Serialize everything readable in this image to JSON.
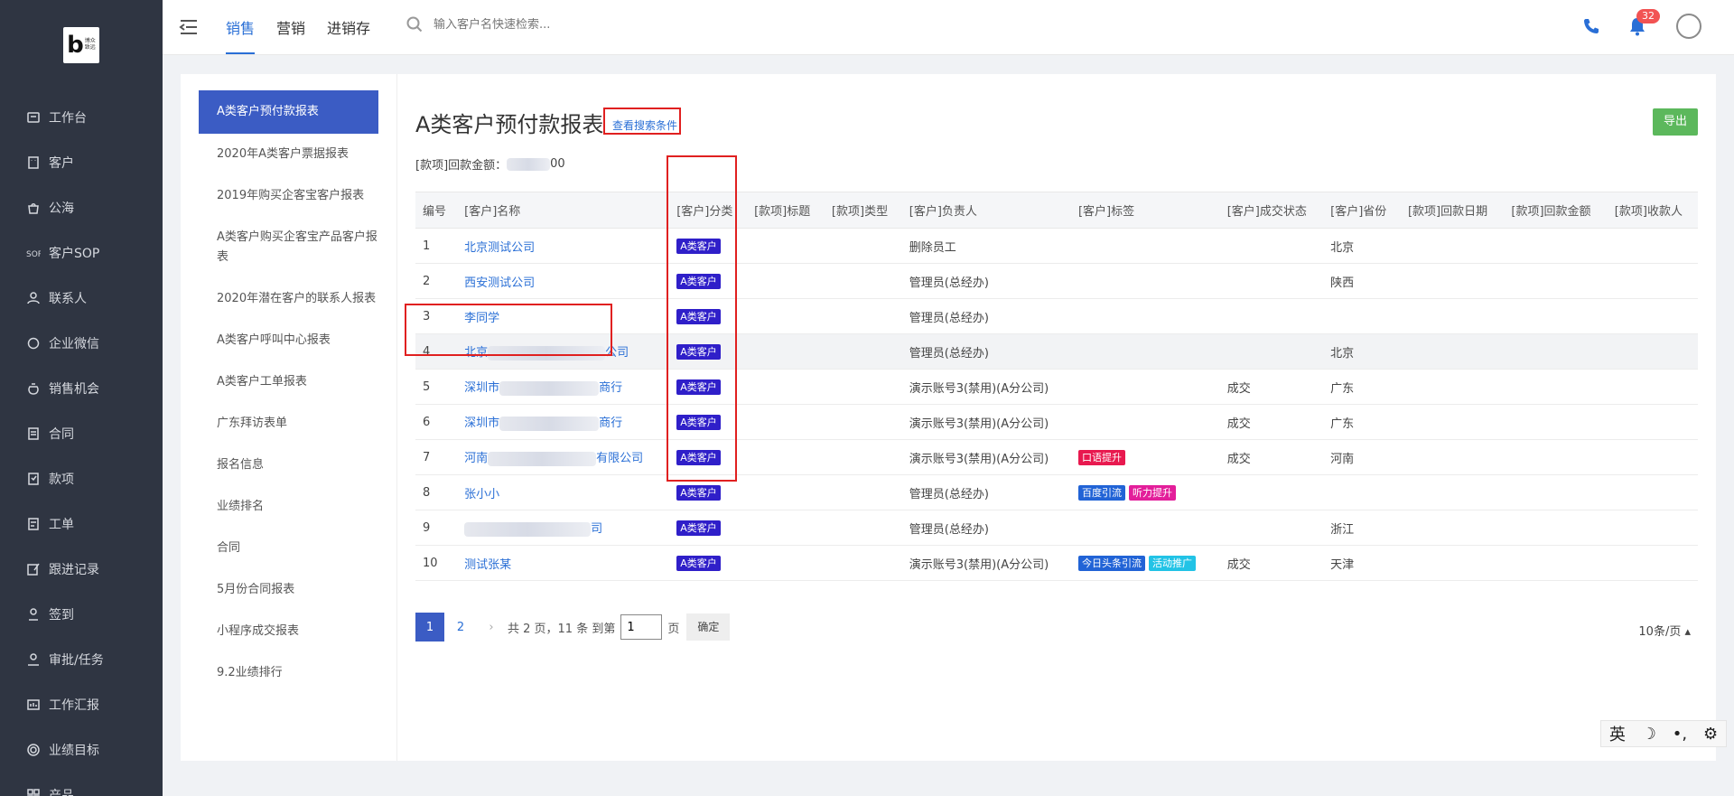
{
  "brand": {
    "logo_letter": "b",
    "logo_text": "博众\n致远"
  },
  "sidebar": {
    "items": [
      {
        "label": "工作台",
        "icon": "dashboard-icon"
      },
      {
        "label": "客户",
        "icon": "building-icon"
      },
      {
        "label": "公海",
        "icon": "bag-icon"
      },
      {
        "label": "客户SOP",
        "icon": "sop-icon"
      },
      {
        "label": "联系人",
        "icon": "user-icon"
      },
      {
        "label": "企业微信",
        "icon": "chat-icon"
      },
      {
        "label": "销售机会",
        "icon": "money-bag-icon"
      },
      {
        "label": "合同",
        "icon": "contract-icon"
      },
      {
        "label": "款项",
        "icon": "payment-icon"
      },
      {
        "label": "工单",
        "icon": "ticket-icon"
      },
      {
        "label": "跟进记录",
        "icon": "edit-icon"
      },
      {
        "label": "签到",
        "icon": "pin-user-icon"
      },
      {
        "label": "审批/任务",
        "icon": "approve-icon"
      },
      {
        "label": "工作汇报",
        "icon": "report-icon"
      },
      {
        "label": "业绩目标",
        "icon": "target-icon"
      },
      {
        "label": "产品",
        "icon": "grid-icon"
      }
    ]
  },
  "topbar": {
    "tabs": [
      {
        "label": "销售",
        "active": true
      },
      {
        "label": "营销"
      },
      {
        "label": "进销存"
      }
    ],
    "search_placeholder": "输入客户名快速检索...",
    "notification_count": "32"
  },
  "reports": [
    "A类客户预付款报表",
    "2020年A类客户票据报表",
    "2019年购买企客宝客户报表",
    "A类客户购买企客宝产品客户报表",
    "2020年潜在客户的联系人报表",
    "A类客户呼叫中心报表",
    "A类客户工单报表",
    "广东拜访表单",
    "报名信息",
    "业绩排名",
    "合同",
    "5月份合同报表",
    "小程序成交报表",
    "9.2业绩排行"
  ],
  "main": {
    "title": "A类客户预付款报表",
    "view_conditions": "查看搜索条件",
    "export_label": "导出",
    "amount_label": "[款项]回款金额：",
    "amount_suffix": "00",
    "columns": [
      "编号",
      "[客户]名称",
      "[客户]分类",
      "[款项]标题",
      "[款项]类型",
      "[客户]负责人",
      "[客户]标签",
      "[客户]成交状态",
      "[客户]省份",
      "[款项]回款日期",
      "[款项]回款金额",
      "[款项]收款人"
    ],
    "rows": [
      {
        "no": "1",
        "name": "北京测试公司",
        "cat": "A类客户",
        "owner": "删除员工",
        "status": "",
        "province": "北京"
      },
      {
        "no": "2",
        "name": "西安测试公司",
        "cat": "A类客户",
        "owner": "管理员(总经办)",
        "status": "",
        "province": "陕西"
      },
      {
        "no": "3",
        "name": "李同学",
        "cat": "A类客户",
        "owner": "管理员(总经办)",
        "status": "",
        "province": ""
      },
      {
        "no": "4",
        "name": "北京",
        "name_suffix": "公司",
        "cat": "A类客户",
        "owner": "管理员(总经办)",
        "status": "",
        "province": "北京"
      },
      {
        "no": "5",
        "name": "深圳市",
        "name_suffix": "商行",
        "cat": "A类客户",
        "owner": "演示账号3(禁用)(A分公司)",
        "status": "成交",
        "province": "广东"
      },
      {
        "no": "6",
        "name": "深圳市",
        "name_suffix": "商行",
        "cat": "A类客户",
        "owner": "演示账号3(禁用)(A分公司)",
        "status": "成交",
        "province": "广东"
      },
      {
        "no": "7",
        "name": "河南",
        "name_suffix": "有限公司",
        "cat": "A类客户",
        "owner": "演示账号3(禁用)(A分公司)",
        "status": "成交",
        "province": "河南"
      },
      {
        "no": "8",
        "name": "张小小",
        "cat": "A类客户",
        "owner": "管理员(总经办)",
        "status": "",
        "province": ""
      },
      {
        "no": "9",
        "name": "",
        "name_suffix": "司",
        "cat": "A类客户",
        "owner": "管理员(总经办)",
        "status": "",
        "province": "浙江"
      },
      {
        "no": "10",
        "name": "测试张某",
        "cat": "A类客户",
        "owner": "演示账号3(禁用)(A分公司)",
        "status": "成交",
        "province": "天津"
      }
    ],
    "tags": {
      "row7": [
        {
          "label": "口语提升",
          "color": "#e8194f"
        }
      ],
      "row8": [
        {
          "label": "百度引流",
          "color": "#2163d6"
        },
        {
          "label": "听力提升",
          "color": "#e31e9a"
        }
      ],
      "row10": [
        {
          "label": "今日头条引流",
          "color": "#2163d6"
        },
        {
          "label": "活动推广",
          "color": "#22c3e6"
        }
      ]
    }
  },
  "pager": {
    "pages": [
      "1",
      "2"
    ],
    "summary": "共 2 页，11 条 到第",
    "goto_value": "1",
    "page_unit": "页",
    "ok_label": "确定",
    "page_size": "10条/页 ▴"
  },
  "ime": {
    "lang": "英",
    "moon": "☽",
    "dot": "•,",
    "gear": "⚙"
  },
  "colors": {
    "sidebar_bg": "#2f3542",
    "accent": "#2a6fd6",
    "active_report": "#3b5cc4",
    "export": "#5cb85c",
    "tag_category": "#2f1fc9"
  }
}
